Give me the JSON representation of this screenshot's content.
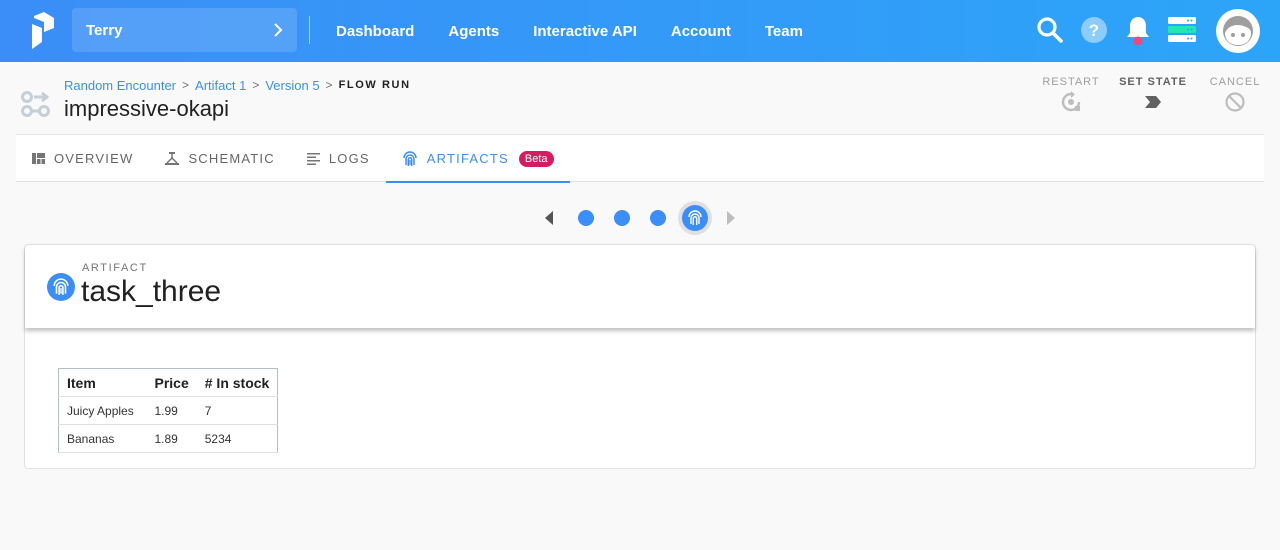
{
  "appbar": {
    "team_name": "Terry",
    "nav": [
      "Dashboard",
      "Agents",
      "Interactive API",
      "Account",
      "Team"
    ],
    "icons": [
      "search-icon",
      "help-icon",
      "notifications-bell-icon",
      "server-status-icon",
      "user-avatar"
    ],
    "colors": {
      "bar": "#3b8ef7",
      "bell_accent": "#f0487a",
      "server_accent": "#1de9b6"
    }
  },
  "header": {
    "breadcrumb": [
      "Random Encounter",
      "Artifact 1",
      "Version 5"
    ],
    "breadcrumb_current": "FLOW RUN",
    "title": "impressive-okapi",
    "actions": [
      {
        "label": "RESTART",
        "icon": "restart-icon",
        "enabled": false
      },
      {
        "label": "SET STATE",
        "icon": "set-state-icon",
        "enabled": true
      },
      {
        "label": "CANCEL",
        "icon": "cancel-icon",
        "enabled": false
      }
    ]
  },
  "tabs": [
    {
      "label": "OVERVIEW",
      "icon": "overview-icon",
      "active": false
    },
    {
      "label": "SCHEMATIC",
      "icon": "schematic-icon",
      "active": false
    },
    {
      "label": "LOGS",
      "icon": "logs-icon",
      "active": false
    },
    {
      "label": "ARTIFACTS",
      "icon": "fingerprint-icon",
      "active": true,
      "badge": "Beta"
    }
  ],
  "pager": {
    "total": 4,
    "current": 4
  },
  "artifact": {
    "kind_label": "ARTIFACT",
    "name": "task_three",
    "table": {
      "headers": [
        "Item",
        "Price",
        "# In stock"
      ],
      "rows": [
        [
          "Juicy Apples",
          "1.99",
          "7"
        ],
        [
          "Bananas",
          "1.89",
          "5234"
        ]
      ]
    }
  }
}
